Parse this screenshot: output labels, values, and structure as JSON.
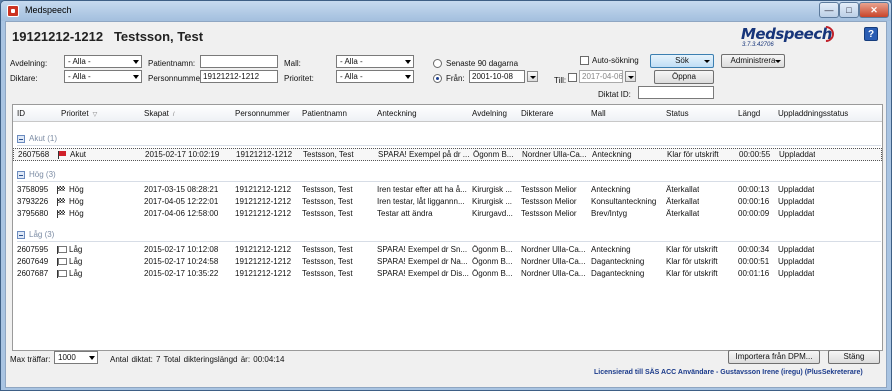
{
  "window": {
    "title": "Medspeech",
    "minimize": "—",
    "maximize": "□",
    "close": "✕"
  },
  "patient": {
    "id": "19121212-1212",
    "name": "Testsson, Test"
  },
  "logo": {
    "text": "Medspeech",
    "version": "3.7.3.42706"
  },
  "help_label": "?",
  "filters": {
    "avdelning_label": "Avdelning:",
    "avdelning_value": "- Alla -",
    "diktare_label": "Diktare:",
    "diktare_value": "- Alla -",
    "patientnamn_label": "Patientnamn:",
    "patientnamn_value": "",
    "personnummer_label": "Personnummer:",
    "personnummer_value": "19121212-1212",
    "mall_label": "Mall:",
    "mall_value": "- Alla -",
    "prioritet_label": "Prioritet:",
    "prioritet_value": "- Alla -",
    "senaste_label": "Senaste 90 dagarna",
    "fran_label": "Från:",
    "fran_value": "2001-10-08",
    "till_label": "Till:",
    "till_value": "2017-04-06",
    "autosokning_label": "Auto-sökning",
    "diktat_id_label": "Diktat ID:",
    "diktat_id_value": ""
  },
  "buttons": {
    "sok": "Sök",
    "oppna": "Öppna",
    "administrera": "Administrera",
    "importera": "Importera från DPM...",
    "stang": "Stäng"
  },
  "columns": [
    "ID",
    "Prioritet",
    "Skapat",
    "Personnummer",
    "Patientnamn",
    "Anteckning",
    "Avdelning",
    "Dikterare",
    "Mall",
    "Status",
    "Längd",
    "Uppladdningsstatus"
  ],
  "groups": [
    {
      "label": "Akut (1)",
      "rows": [
        {
          "id": "2607568",
          "prio": "Akut",
          "flag": "red",
          "skapat": "2015-02-17 10:02:19",
          "pnr": "19121212-1212",
          "namn": "Testsson, Test",
          "anteckning": "SPARA! Exempel på dr ...",
          "avdelning": "Ögonm B...",
          "dikterare": "Nordner Ulla-Ca...",
          "mall": "Anteckning",
          "status": "Klar för utskrift",
          "langd": "00:00:55",
          "upp": "Uppladdat",
          "selected": true
        }
      ]
    },
    {
      "label": "Hög (3)",
      "rows": [
        {
          "id": "3758095",
          "prio": "Hög",
          "flag": "check",
          "skapat": "2017-03-15 08:28:21",
          "pnr": "19121212-1212",
          "namn": "Testsson, Test",
          "anteckning": "Iren testar efter att ha å...",
          "avdelning": "Kirurgisk ...",
          "dikterare": "Testsson Melior",
          "mall": "Anteckning",
          "status": "Återkallat",
          "langd": "00:00:13",
          "upp": "Uppladdat"
        },
        {
          "id": "3793226",
          "prio": "Hög",
          "flag": "check",
          "skapat": "2017-04-05 12:22:01",
          "pnr": "19121212-1212",
          "namn": "Testsson, Test",
          "anteckning": "Iren testar, låt liggannn...",
          "avdelning": "Kirurgisk ...",
          "dikterare": "Testsson Melior",
          "mall": "Konsultanteckning",
          "status": "Återkallat",
          "langd": "00:00:16",
          "upp": "Uppladdat"
        },
        {
          "id": "3795680",
          "prio": "Hög",
          "flag": "check",
          "skapat": "2017-04-06 12:58:00",
          "pnr": "19121212-1212",
          "namn": "Testsson, Test",
          "anteckning": "Testar att ändra",
          "avdelning": "Kirurgavd...",
          "dikterare": "Testsson Melior",
          "mall": "Brev/Intyg",
          "status": "Återkallat",
          "langd": "00:00:09",
          "upp": "Uppladdat"
        }
      ]
    },
    {
      "label": "Låg (3)",
      "rows": [
        {
          "id": "2607595",
          "prio": "Låg",
          "flag": "white",
          "skapat": "2015-02-17 10:12:08",
          "pnr": "19121212-1212",
          "namn": "Testsson, Test",
          "anteckning": "SPARA! Exempel dr Sn...",
          "avdelning": "Ögonm B...",
          "dikterare": "Nordner Ulla-Ca...",
          "mall": "Anteckning",
          "status": "Klar för utskrift",
          "langd": "00:00:34",
          "upp": "Uppladdat"
        },
        {
          "id": "2607649",
          "prio": "Låg",
          "flag": "white",
          "skapat": "2015-02-17 10:24:58",
          "pnr": "19121212-1212",
          "namn": "Testsson, Test",
          "anteckning": "SPARA! Exempel dr Na...",
          "avdelning": "Ögonm B...",
          "dikterare": "Nordner Ulla-Ca...",
          "mall": "Daganteckning",
          "status": "Klar för utskrift",
          "langd": "00:00:51",
          "upp": "Uppladdat"
        },
        {
          "id": "2607687",
          "prio": "Låg",
          "flag": "white",
          "skapat": "2015-02-17 10:35:22",
          "pnr": "19121212-1212",
          "namn": "Testsson, Test",
          "anteckning": "SPARA! Exempel dr Dis...",
          "avdelning": "Ögonm B...",
          "dikterare": "Nordner Ulla-Ca...",
          "mall": "Daganteckning",
          "status": "Klar för utskrift",
          "langd": "00:01:16",
          "upp": "Uppladdat"
        }
      ]
    }
  ],
  "footer": {
    "max_label": "Max träffar:",
    "max_value": "1000",
    "summary": "Antal diktat: 7   Total dikteringslängd är: 00:04:14",
    "license": "Licensierad till SÄS ACC Användare - Gustavsson Irene (iregu) (PlusSekreterare)"
  }
}
